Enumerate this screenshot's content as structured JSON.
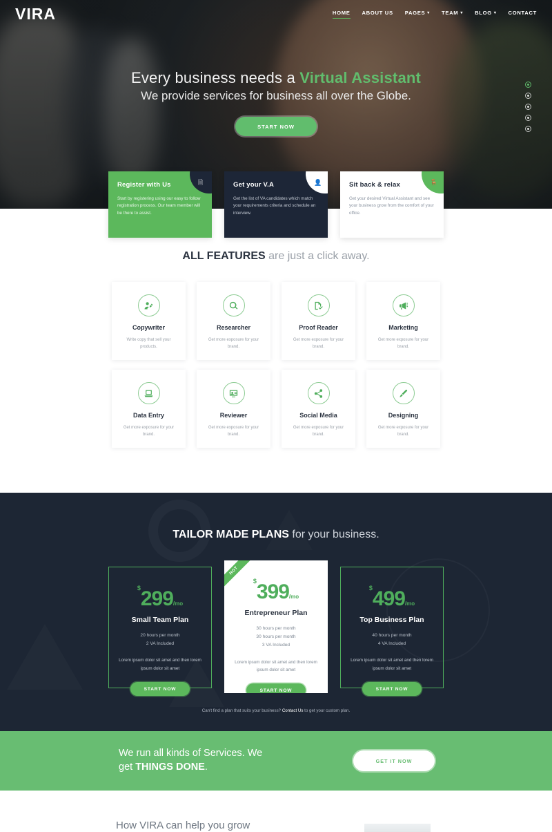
{
  "brand": {
    "logo": "VIRA",
    "accent": "#5cb85c",
    "dark": "#1d2634"
  },
  "nav": {
    "items": [
      {
        "label": "HOME",
        "active": true,
        "caret": ""
      },
      {
        "label": "ABOUT US",
        "active": false,
        "caret": ""
      },
      {
        "label": "PAGES",
        "active": false,
        "caret": "▾"
      },
      {
        "label": "TEAM",
        "active": false,
        "caret": "▾"
      },
      {
        "label": "BLOG",
        "active": false,
        "caret": "▾"
      },
      {
        "label": "CONTACT",
        "active": false,
        "caret": ""
      }
    ]
  },
  "hero": {
    "title_plain": "Every business needs a ",
    "title_accent": "Virtual Assistant",
    "subtitle": "We provide services for business all over the Globe.",
    "cta_label": "START NOW",
    "dots": [
      "slide-1",
      "slide-2",
      "slide-3",
      "slide-4",
      "slide-5"
    ]
  },
  "steps": [
    {
      "title": "Register with Us",
      "desc": "Start by registering using our easy to follow registration process. Our team member will be there to assist.",
      "icon": "document-icon",
      "glyph": "🗎"
    },
    {
      "title": "Get your V.A",
      "desc": "Get the list of VA candidates which match your requirements criteria and schedule an interview.",
      "icon": "user-badge-icon",
      "glyph": "👤"
    },
    {
      "title": "Sit back & relax",
      "desc": "Get your desired Virtual Assistant and see your business grow from the comfort of your office.",
      "icon": "chair-icon",
      "glyph": "🪑"
    }
  ],
  "features": {
    "title_bold": "ALL FEATURES",
    "title_rest": " are just a click away.",
    "items": [
      {
        "name": "Copywriter",
        "desc": "Write copy that sell your products.",
        "icon": "user-edit-icon"
      },
      {
        "name": "Researcher",
        "desc": "Get more exposure for your brand.",
        "icon": "search-icon"
      },
      {
        "name": "Proof Reader",
        "desc": "Get more exposure for your brand.",
        "icon": "document-check-icon"
      },
      {
        "name": "Marketing",
        "desc": "Get more exposure for your brand.",
        "icon": "megaphone-icon"
      },
      {
        "name": "Data Entry",
        "desc": "Get more exposure for your brand.",
        "icon": "laptop-code-icon"
      },
      {
        "name": "Reviewer",
        "desc": "Get more exposure for your brand.",
        "icon": "review-screen-icon"
      },
      {
        "name": "Social Media",
        "desc": "Get more exposure for your brand.",
        "icon": "share-icon"
      },
      {
        "name": "Designing",
        "desc": "Get more exposure for your brand.",
        "icon": "paint-brush-icon"
      }
    ]
  },
  "pricing": {
    "title_bold": "TAILOR MADE PLANS",
    "title_rest": " for your business.",
    "plans": [
      {
        "currency": "$",
        "amount": "299",
        "period": "/mo",
        "name": "Small Team Plan",
        "features": "20 hours per month\n2 VA Included",
        "note": "Lorem ipsum dolor sit amet and then lorem ipsum dolor sit amet",
        "cta": "START NOW",
        "featured": false,
        "badge": ""
      },
      {
        "currency": "$",
        "amount": "399",
        "period": "/mo",
        "name": "Entrepreneur Plan",
        "features": "30 hours per month\n30 hours per month\n3 VA Included",
        "note": "Lorem ipsum dolor sit amet and then lorem ipsum dolor sit amet",
        "cta": "START NOW",
        "featured": true,
        "badge": "HOT"
      },
      {
        "currency": "$",
        "amount": "499",
        "period": "/mo",
        "name": "Top Business Plan",
        "features": "40 hours per month\n4 VA Included",
        "note": "Lorem ipsum dolor sit amet and then lorem ipsum dolor sit amet",
        "cta": "START NOW",
        "featured": false,
        "badge": ""
      }
    ],
    "note_before": "Can't find a plan that suits your business? ",
    "note_link": "Contact Us",
    "note_after": " to get your custom plan."
  },
  "cta_banner": {
    "line1": "We run all kinds of Services. We",
    "line2_plain": "get ",
    "line2_bold": "THINGS DONE",
    "line2_end": ".",
    "button": "GET IT NOW"
  },
  "bottom": {
    "title": "How VIRA can help you grow"
  }
}
